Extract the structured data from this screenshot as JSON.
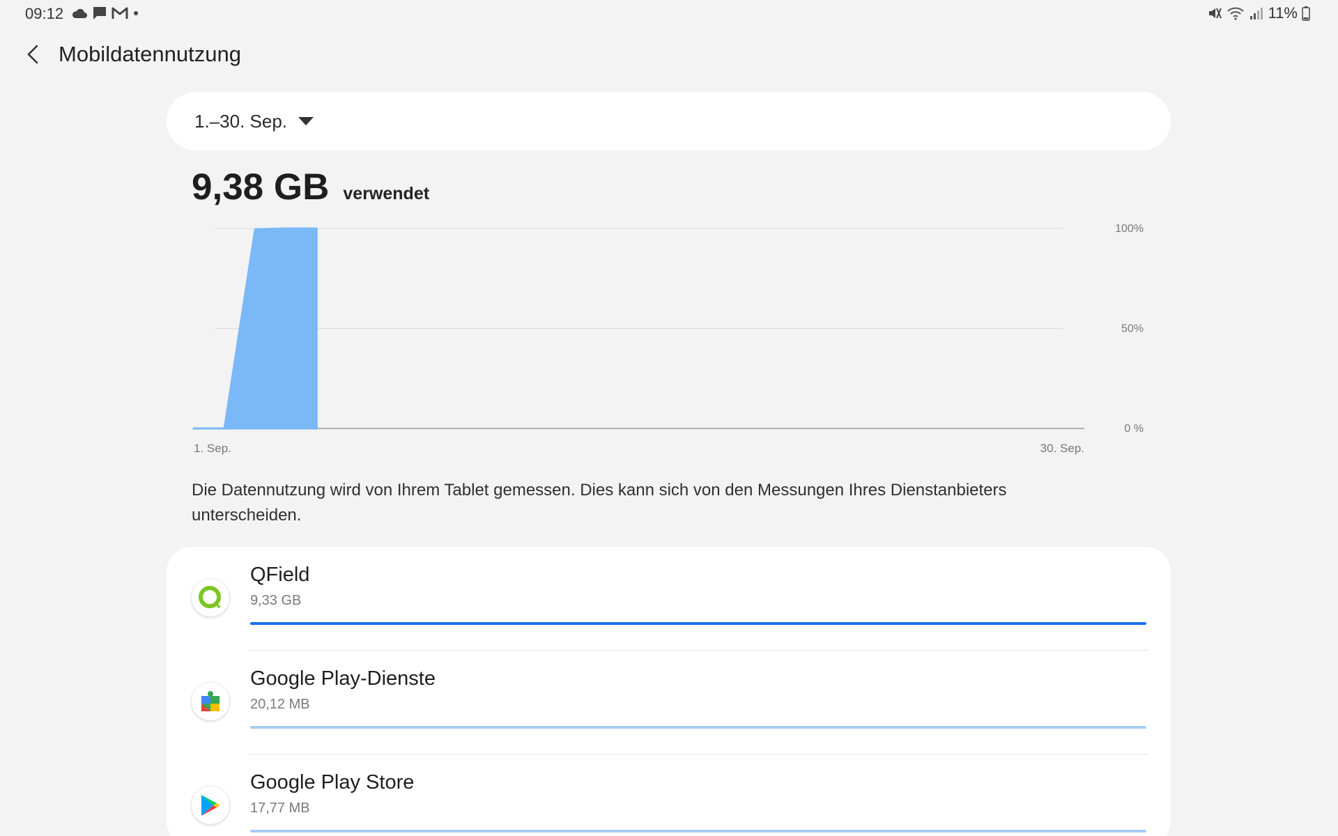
{
  "status_bar": {
    "time": "09:12",
    "left_icons": [
      "cloud-icon",
      "chat-icon",
      "gmail-icon",
      "dot-icon"
    ],
    "right_icons": [
      "mute-icon",
      "wifi-icon",
      "signal-icon",
      "battery-icon"
    ],
    "battery": "11%"
  },
  "header": {
    "title": "Mobildatennutzung"
  },
  "period": {
    "label": "1.–30. Sep."
  },
  "total": {
    "value": "9,38 GB",
    "suffix": "verwendet"
  },
  "chart_data": {
    "type": "area",
    "x_start_label": "1. Sep.",
    "x_end_label": "30. Sep.",
    "y_ticks": [
      "100%",
      "50%",
      "0 %"
    ],
    "ylim": [
      0,
      100
    ],
    "x_days": [
      1,
      30
    ],
    "points": [
      {
        "day": 1,
        "percent": 0
      },
      {
        "day": 2,
        "percent": 0
      },
      {
        "day": 3,
        "percent": 99.6
      },
      {
        "day": 4,
        "percent": 100
      },
      {
        "day": 5,
        "percent": 100
      },
      {
        "day": 5,
        "percent": 0
      }
    ],
    "grid": true,
    "color": "#7bb8f7"
  },
  "note": "Die Datennutzung wird von Ihrem Tablet gemessen. Dies kann sich von den Messungen Ihres Dienstanbieters unterscheiden.",
  "apps": [
    {
      "name": "QField",
      "size": "9,33 GB",
      "icon": "qfield-icon",
      "usage_fraction": 1.0,
      "bar_color": "#1a73e8"
    },
    {
      "name": "Google Play-Dienste",
      "size": "20,12 MB",
      "icon": "google-play-services-icon",
      "usage_fraction": 1.0,
      "bar_color": "#a8cdf3"
    },
    {
      "name": "Google Play Store",
      "size": "17,77 MB",
      "icon": "google-play-store-icon",
      "usage_fraction": 1.0,
      "bar_color": "#a8cdf3"
    }
  ]
}
